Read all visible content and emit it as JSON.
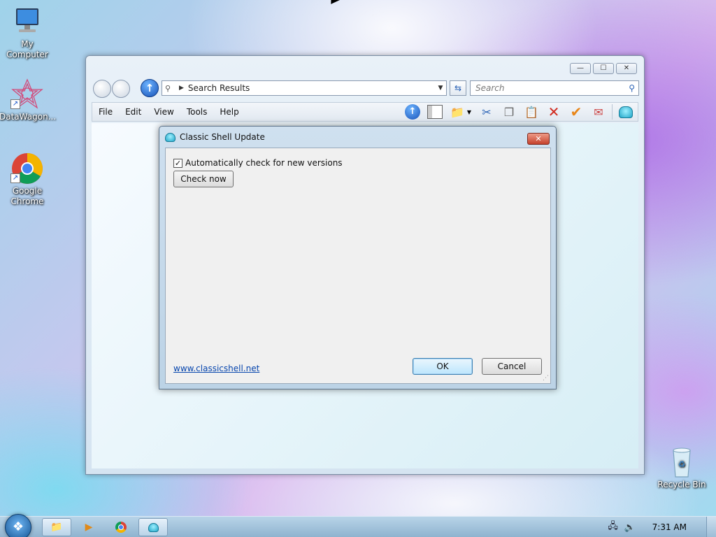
{
  "desktop": {
    "icons": [
      {
        "label": "My Computer",
        "icon": "computer-icon"
      },
      {
        "label": "DataWagon...",
        "icon": "datawagon-icon"
      },
      {
        "label": "Google Chrome",
        "icon": "chrome-icon"
      },
      {
        "label": "Recycle Bin",
        "icon": "recycle-bin-icon"
      }
    ]
  },
  "explorer": {
    "address": "Search Results",
    "search_placeholder": "Search",
    "menu": [
      "File",
      "Edit",
      "View",
      "Tools",
      "Help"
    ],
    "caption_buttons": {
      "minimize": "—",
      "maximize": "☐",
      "close": "✕"
    }
  },
  "dialog": {
    "title": "Classic Shell Update",
    "checkbox_label": "Automatically check for new versions",
    "checkbox_checked": true,
    "check_now_label": "Check now",
    "link_text": "www.classicshell.net",
    "ok_label": "OK",
    "cancel_label": "Cancel",
    "close_glyph": "✕"
  },
  "taskbar": {
    "clock": "7:31 AM",
    "apps": [
      "explorer-icon",
      "media-player-icon",
      "chrome-icon",
      "classic-shell-icon"
    ]
  },
  "colors": {
    "accent": "#3c7fb1",
    "link": "#0645ad",
    "close_red": "#c5412c"
  }
}
